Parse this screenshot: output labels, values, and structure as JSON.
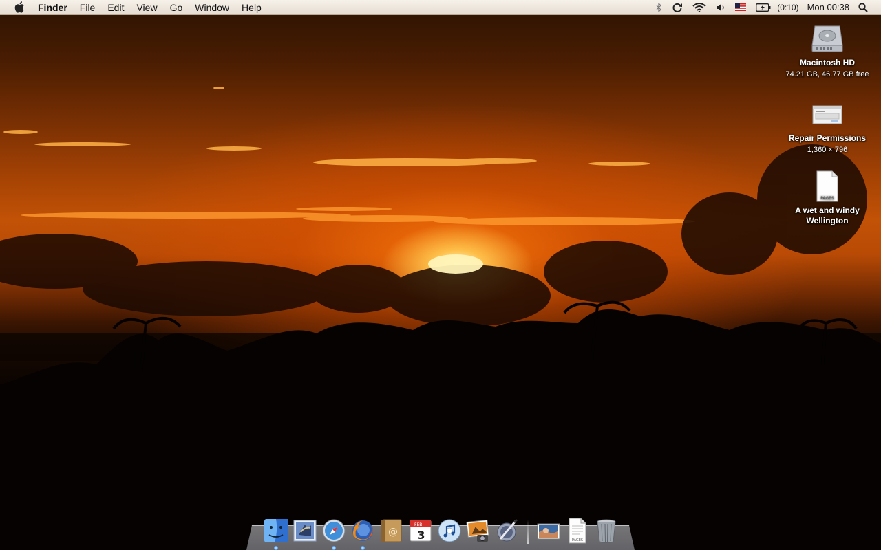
{
  "menubar": {
    "apple_icon": "apple-icon",
    "items": [
      {
        "label": "Finder",
        "bold": true
      },
      {
        "label": "File"
      },
      {
        "label": "Edit"
      },
      {
        "label": "View"
      },
      {
        "label": "Go"
      },
      {
        "label": "Window"
      },
      {
        "label": "Help"
      }
    ],
    "status": {
      "battery_time": "(0:10)",
      "clock": "Mon 00:38"
    }
  },
  "desktop": {
    "icons": [
      {
        "label": "Macintosh HD",
        "sub": "74.21 GB, 46.77 GB free",
        "icon": "hard-drive-icon"
      },
      {
        "label": "Repair Permissions",
        "sub": "1,360 × 796",
        "icon": "screenshot-icon"
      },
      {
        "label": "A wet and windy Wellington",
        "sub": "",
        "icon": "pages-document-icon",
        "badge": "PAGES"
      }
    ]
  },
  "dock": {
    "apps": [
      {
        "name": "Finder",
        "icon": "finder-icon",
        "running": true
      },
      {
        "name": "Mail",
        "icon": "mail-icon",
        "running": false
      },
      {
        "name": "Safari",
        "icon": "safari-icon",
        "running": true
      },
      {
        "name": "Firefox",
        "icon": "firefox-icon",
        "running": true
      },
      {
        "name": "Address Book",
        "icon": "address-book-icon",
        "running": false
      },
      {
        "name": "iCal",
        "icon": "ical-icon",
        "running": false,
        "day": "3",
        "month": "FEB"
      },
      {
        "name": "iTunes",
        "icon": "itunes-icon",
        "running": false
      },
      {
        "name": "iPhoto",
        "icon": "iphoto-icon",
        "running": false
      },
      {
        "name": "Script Editor",
        "icon": "script-editor-icon",
        "running": false
      }
    ],
    "stack": [
      {
        "name": "Picture",
        "icon": "picture-icon"
      },
      {
        "name": "Pages Document",
        "icon": "pages-document-icon",
        "badge": "PAGES"
      },
      {
        "name": "Trash",
        "icon": "trash-icon"
      }
    ]
  },
  "colors": {
    "menubar_bg": "#efe8de",
    "sky_orange": "#c25206",
    "sun": "#fff6c8"
  }
}
